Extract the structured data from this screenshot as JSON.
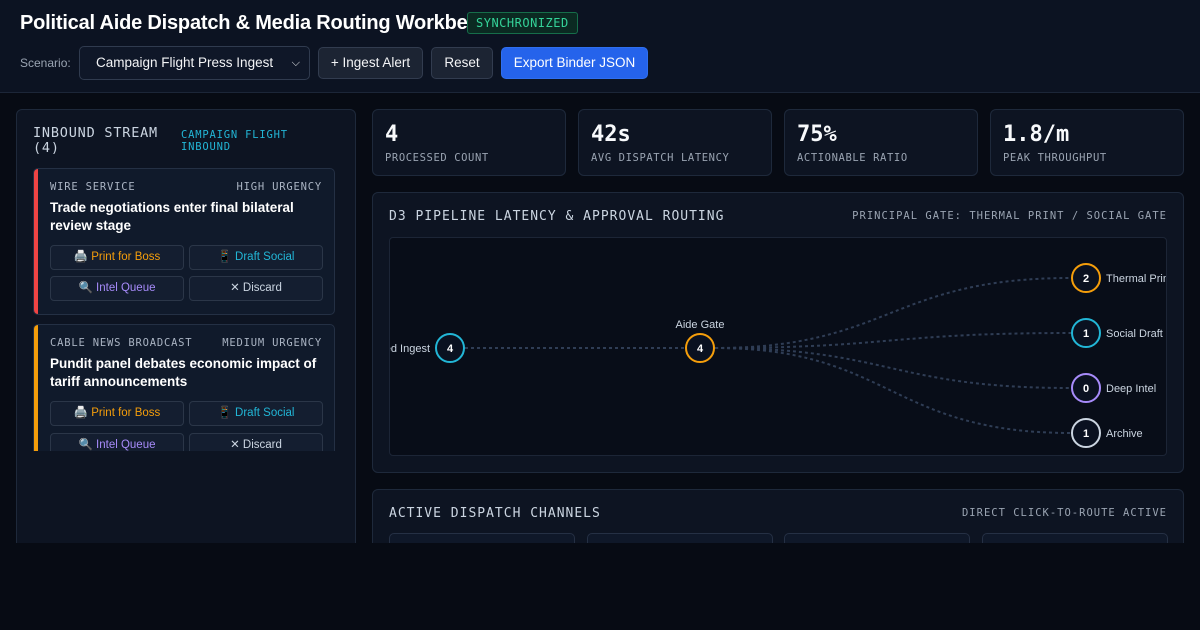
{
  "header": {
    "title": "Political Aide Dispatch & Media Routing Workbench",
    "status_badge": "SYNCHRONIZED",
    "scenario_label": "Scenario:",
    "scenario_selected": "Campaign Flight Press Ingest",
    "buttons": {
      "ingest": "+ Ingest Alert",
      "reset": "Reset",
      "export": "Export Binder JSON"
    }
  },
  "inbound": {
    "title": "INBOUND STREAM (4)",
    "tag": "CAMPAIGN FLIGHT INBOUND",
    "cards": [
      {
        "source": "WIRE SERVICE",
        "urgency": "HIGH URGENCY",
        "urgency_color": "#ef4444",
        "headline": "Trade negotiations enter final bilateral review stage"
      },
      {
        "source": "CABLE NEWS BROADCAST",
        "urgency": "MEDIUM URGENCY",
        "urgency_color": "#f59e0b",
        "headline": "Pundit panel debates economic impact of tariff announcements"
      }
    ],
    "actions": {
      "print": {
        "icon": "printer-icon",
        "glyph": "🖨️",
        "label": "Print for Boss",
        "color": "#f59e0b"
      },
      "social": {
        "icon": "phone-icon",
        "glyph": "📱",
        "label": "Draft Social",
        "color": "#22b6d6"
      },
      "intel": {
        "icon": "magnifier-icon",
        "glyph": "🔍",
        "label": "Intel Queue",
        "color": "#a78bfa"
      },
      "discard": {
        "icon": "close-icon",
        "glyph": "✕",
        "label": "Discard",
        "color": "#cbd5e1"
      }
    }
  },
  "metrics": [
    {
      "value": "4",
      "label": "PROCESSED COUNT"
    },
    {
      "value": "42s",
      "label": "AVG DISPATCH LATENCY"
    },
    {
      "value": "75%",
      "label": "ACTIONABLE RATIO"
    },
    {
      "value": "1.8/m",
      "label": "PEAK THROUGHPUT"
    }
  ],
  "pipeline": {
    "title": "D3 PIPELINE LATENCY & APPROVAL ROUTING",
    "gate_label": "PRINCIPAL GATE: THERMAL PRINT / SOCIAL GATE",
    "nodes": {
      "ingest": {
        "label": "Feed Ingest",
        "count": "4",
        "color": "#22b6d6"
      },
      "gate": {
        "label": "Aide Gate",
        "count": "4",
        "color": "#f59e0b"
      },
      "thermal": {
        "label": "Thermal Print",
        "count": "2",
        "color": "#f59e0b"
      },
      "social": {
        "label": "Social Draft",
        "count": "1",
        "color": "#22b6d6"
      },
      "intel": {
        "label": "Deep Intel",
        "count": "0",
        "color": "#a78bfa"
      },
      "archive": {
        "label": "Archive",
        "count": "1",
        "color": "#cbd5e1"
      }
    }
  },
  "dispatch": {
    "title": "ACTIVE DISPATCH CHANNELS",
    "subtitle": "DIRECT CLICK-TO-ROUTE ACTIVE"
  },
  "colors": {
    "accent": "#2563eb",
    "sync": "#34d399",
    "high": "#ef4444",
    "medium": "#f59e0b",
    "cyan": "#22b6d6",
    "purple": "#a78bfa"
  }
}
